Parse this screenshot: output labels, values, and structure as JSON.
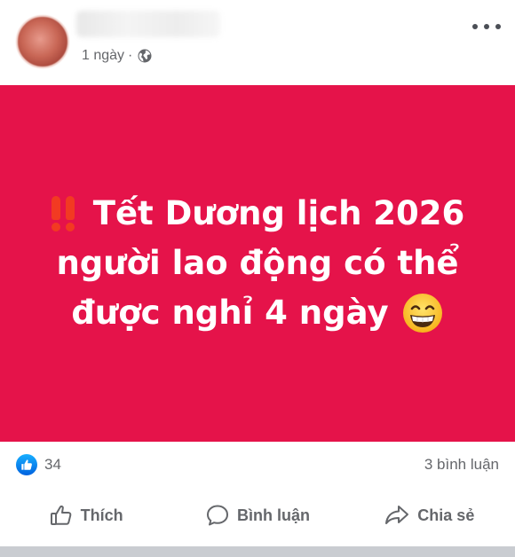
{
  "post": {
    "time": "1 ngày",
    "separator": "·",
    "audience_icon": "globe-icon",
    "card": {
      "background": "#e5134a",
      "line1": "Tết Dương lịch 2026",
      "line2": "người lao động có thể",
      "line3": "được nghỉ 4 ngày",
      "leading_emoji": "double-exclamation-icon",
      "trailing_emoji": "grinning-face-icon"
    },
    "reactions": {
      "icon": "like-icon",
      "count": "34"
    },
    "comments": "3 bình luận",
    "actions": {
      "like": "Thích",
      "comment": "Bình luận",
      "share": "Chia sẻ"
    }
  }
}
